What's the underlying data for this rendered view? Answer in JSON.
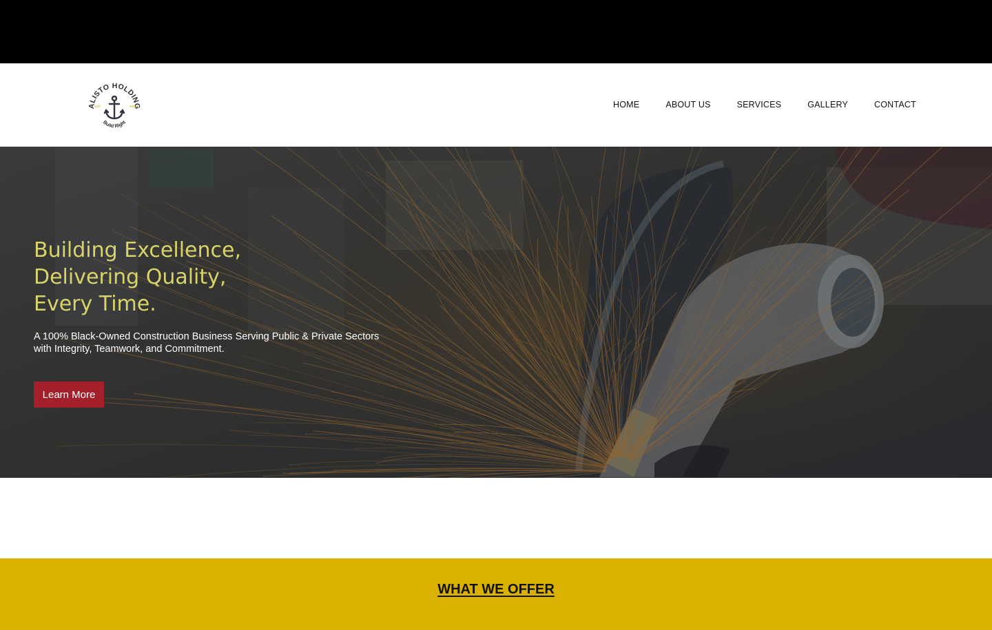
{
  "brand": {
    "logo_top_text": "KALISTO HOLDINGS",
    "logo_bottom_text": "Build Right",
    "logo_est": "EST",
    "logo_year": "2019",
    "accent": "#dbb100"
  },
  "nav": {
    "items": [
      {
        "label": "HOME"
      },
      {
        "label": "ABOUT US"
      },
      {
        "label": "SERVICES"
      },
      {
        "label": "GALLERY"
      },
      {
        "label": "CONTACT"
      }
    ]
  },
  "hero": {
    "title_lines": [
      "Building Excellence,",
      "Delivering Quality,",
      "Every Time."
    ],
    "subtitle": "A 100% Black-Owned Construction Business Serving Public & Private Sectors with Integrity, Teamwork, and Commitment.",
    "button_label": "Learn More",
    "title_color": "#d8d46a",
    "button_color": "#a3202a"
  },
  "offer": {
    "title": "WHAT WE OFFER",
    "background": "#dbb100"
  }
}
